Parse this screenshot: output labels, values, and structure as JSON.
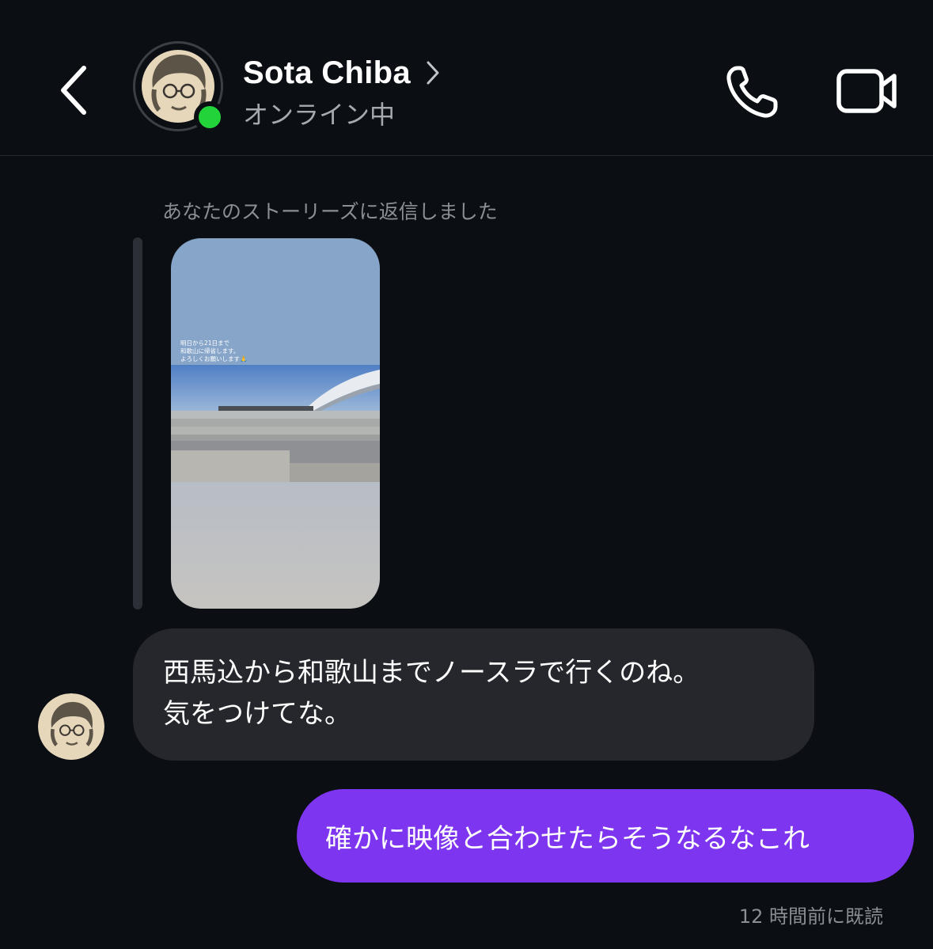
{
  "header": {
    "back_icon": "chevron-left-icon",
    "contact_name": "Sota Chiba",
    "status": "オンライン中",
    "call_icon": "phone-icon",
    "video_icon": "video-camera-icon",
    "online_color": "#22d43a"
  },
  "story_reply": {
    "note": "あなたのストーリーズに返信しました",
    "caption_lines": [
      "明日から21日まで",
      "和歌山に帰省します。",
      "よろしくお願いします🙏"
    ]
  },
  "messages": [
    {
      "direction": "incoming",
      "lines": [
        "西馬込から和歌山までノースラで行くのね。",
        "気をつけてな。"
      ]
    },
    {
      "direction": "outgoing",
      "text": "確かに映像と合わせたらそうなるなこれ",
      "color": "#7d35f0"
    }
  ],
  "read_receipt": "12 時間前に既読"
}
